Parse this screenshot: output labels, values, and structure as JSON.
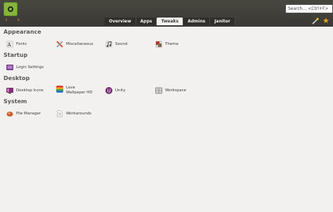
{
  "header": {
    "search_placeholder": "Search... <Ctrl+F>",
    "back_glyph": "‹",
    "forward_glyph": "›",
    "star_glyph": "★",
    "tabs": [
      {
        "label": "Overview"
      },
      {
        "label": "Apps"
      },
      {
        "label": "Tweaks"
      },
      {
        "label": "Admins"
      },
      {
        "label": "Janitor"
      }
    ],
    "active_tab": "Tweaks"
  },
  "sections": {
    "appearance": {
      "title": "Appearance",
      "items": [
        {
          "label": "Fonts",
          "icon": "fonts-icon"
        },
        {
          "label": "Miscellaneous",
          "icon": "tools-icon"
        },
        {
          "label": "Sound",
          "icon": "music-note-icon"
        },
        {
          "label": "Theme",
          "icon": "theme-icon"
        }
      ]
    },
    "startup": {
      "title": "Startup",
      "items": [
        {
          "label": "Login Settings",
          "icon": "login-settings-icon"
        }
      ]
    },
    "desktop": {
      "title": "Desktop",
      "items": [
        {
          "label": "Desktop Icons",
          "icon": "desktop-icons-icon"
        },
        {
          "label": "Love Wallpaper HD",
          "icon": "wallpaper-icon"
        },
        {
          "label": "Unity",
          "icon": "unity-icon"
        },
        {
          "label": "Workspace",
          "icon": "workspace-icon"
        }
      ]
    },
    "system": {
      "title": "System",
      "items": [
        {
          "label": "File Manager",
          "icon": "file-manager-icon"
        },
        {
          "label": "Workarounds",
          "icon": "workarounds-icon"
        }
      ]
    }
  },
  "colors": {
    "header_bg": "#3c3b37",
    "content_bg": "#f2f1f0",
    "accent_orange": "#e07a2b",
    "logo_green": "#86b43f"
  }
}
